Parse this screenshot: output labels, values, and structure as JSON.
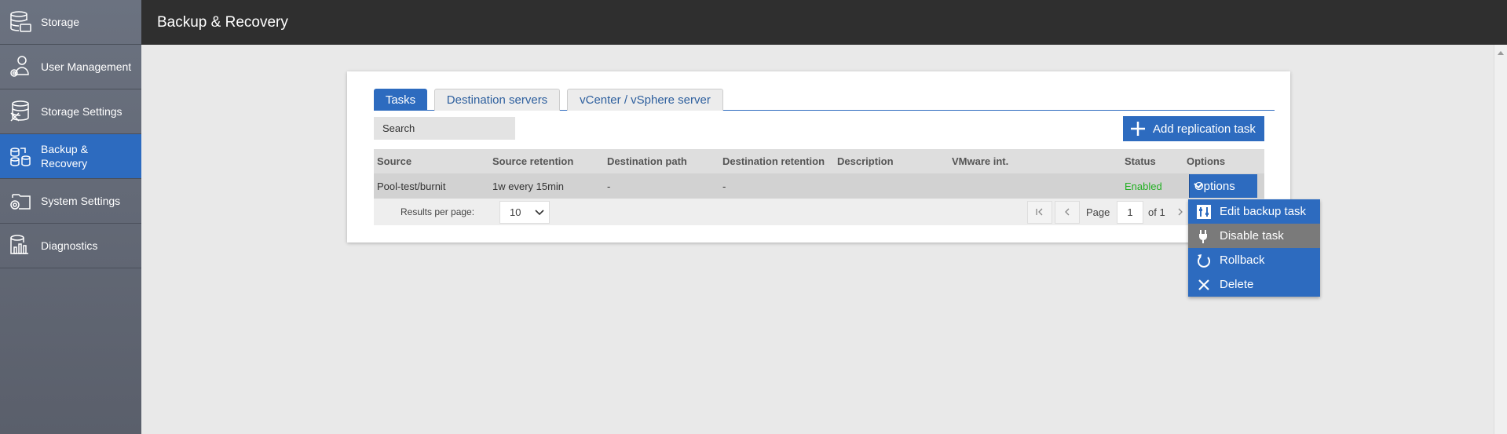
{
  "sidebar": {
    "items": [
      {
        "label": "Storage",
        "icon": "database-icon"
      },
      {
        "label": "User Management",
        "icon": "user-gear-icon"
      },
      {
        "label": "Storage Settings",
        "icon": "database-tools-icon"
      },
      {
        "label": "Backup & Recovery",
        "icon": "backup-icon",
        "active": true
      },
      {
        "label": "System Settings",
        "icon": "folder-gear-icon"
      },
      {
        "label": "Diagnostics",
        "icon": "diagnostics-icon"
      }
    ]
  },
  "header": {
    "title": "Backup & Recovery"
  },
  "tabs": [
    {
      "label": "Tasks",
      "active": true
    },
    {
      "label": "Destination servers"
    },
    {
      "label": "vCenter / vSphere server"
    }
  ],
  "search": {
    "placeholder": "Search"
  },
  "add_button": {
    "label": "Add replication task"
  },
  "table": {
    "columns": [
      "Source",
      "Source retention",
      "Destination path",
      "Destination retention",
      "Description",
      "VMware int.",
      "Status",
      "Options"
    ],
    "rows": [
      {
        "source": "Pool-test/burnit",
        "source_retention": "1w every 15min",
        "destination_path": "-",
        "destination_retention": "-",
        "description": "",
        "vmware": "",
        "status": "Enabled",
        "options": "Options"
      }
    ]
  },
  "pagination": {
    "results_per_page_label": "Results per page:",
    "results_per_page": "10",
    "page_label": "Page",
    "page": "1",
    "of_label": "of 1"
  },
  "options_menu": {
    "items": [
      {
        "label": "Edit backup task",
        "icon": "edit-sliders-icon"
      },
      {
        "label": "Disable task",
        "icon": "plug-icon",
        "hover": true
      },
      {
        "label": "Rollback",
        "icon": "rollback-icon"
      },
      {
        "label": "Delete",
        "icon": "close-icon"
      }
    ]
  },
  "colors": {
    "accent": "#2d6bbf",
    "topbar": "#2f2f2f",
    "status_enabled": "#22b022"
  }
}
